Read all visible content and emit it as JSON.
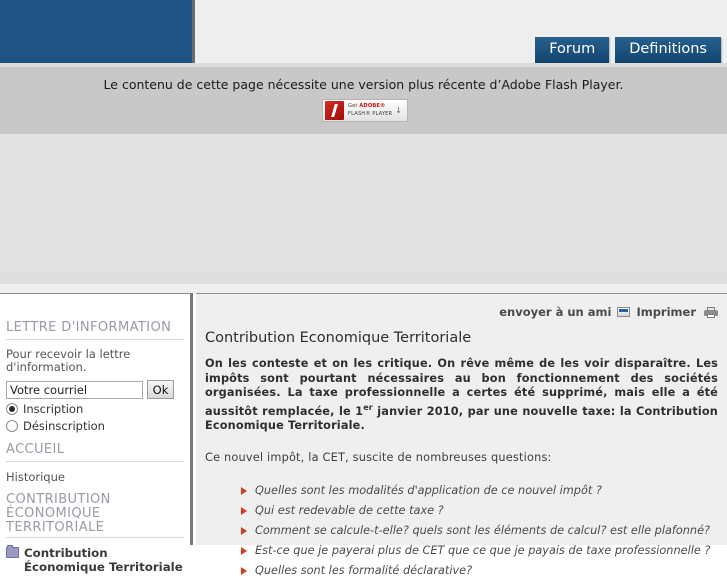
{
  "header": {
    "logo_alt": "site-logo-banner",
    "nav": [
      {
        "label": "Forum"
      },
      {
        "label": "Definitions"
      }
    ]
  },
  "flash": {
    "message": "Le contenu de cette page nécessite une version plus récente d’Adobe Flash Player.",
    "badge_line1_prefix": "Get ",
    "badge_line1_brand": "ADOBE®",
    "badge_line2": "FLASH® PLAYER",
    "badge_arrow": "↓"
  },
  "sidebar": {
    "newsletter": {
      "heading": "LETTRE D'INFORMATION",
      "note": "Pour recevoir la lettre d'information.",
      "email_value": "Votre courriel",
      "email_placeholder": "Votre courriel",
      "ok_label": "Ok",
      "options": [
        {
          "label": "Inscription",
          "checked": true
        },
        {
          "label": "Désinscription",
          "checked": false
        }
      ]
    },
    "accueil": {
      "heading": "ACCUEIL",
      "links": [
        {
          "label": "Historique"
        }
      ]
    },
    "cet": {
      "heading": "CONTRIBUTION ÉCONOMIQUE TERRITORIALE",
      "items": [
        {
          "label": "Contribution Économique Territoriale",
          "icon": "folder-icon"
        }
      ]
    }
  },
  "content": {
    "tools": {
      "send_label": "envoyer à un ami",
      "send_icon": "mail-icon",
      "print_label": "Imprimer",
      "print_icon": "printer-icon"
    },
    "title": "Contribution Economique Territoriale",
    "lead_part1": "On les conteste et on les critique. On rêve même de les voir disparaître. Les impôts sont pourtant nécessaires au bon fonctionnement des sociétés organisées. La taxe professionnelle a certes été supprimé, mais elle a été aussitôt remplacée, le 1",
    "lead_sup": "er",
    "lead_part2": " janvier 2010,  par une nouvelle taxe: la Contribution Economique Territoriale.",
    "subtitle": "Ce nouvel impôt, la CET, suscite de nombreuses questions:",
    "questions": [
      {
        "label": "Quelles sont les modalités d'application de ce nouvel impôt ?"
      },
      {
        "label": "Qui est redevable de cette taxe ?"
      },
      {
        "label": "Comment se calcule-t-elle? quels sont les éléments de calcul? est elle plafonné?"
      },
      {
        "label": "Est-ce que je payerai plus de CET que ce que je payais de taxe professionnelle ?"
      },
      {
        "label": "Quelles sont les formalité déclarative?"
      }
    ]
  },
  "colors": {
    "brand_blue": "#215284",
    "button_blue": "#1b5480",
    "bullet_red": "#d93a1e",
    "flash_bg": "#c8c8c8",
    "panel_gray": "#e2e2e2",
    "content_bg": "#efefef"
  }
}
